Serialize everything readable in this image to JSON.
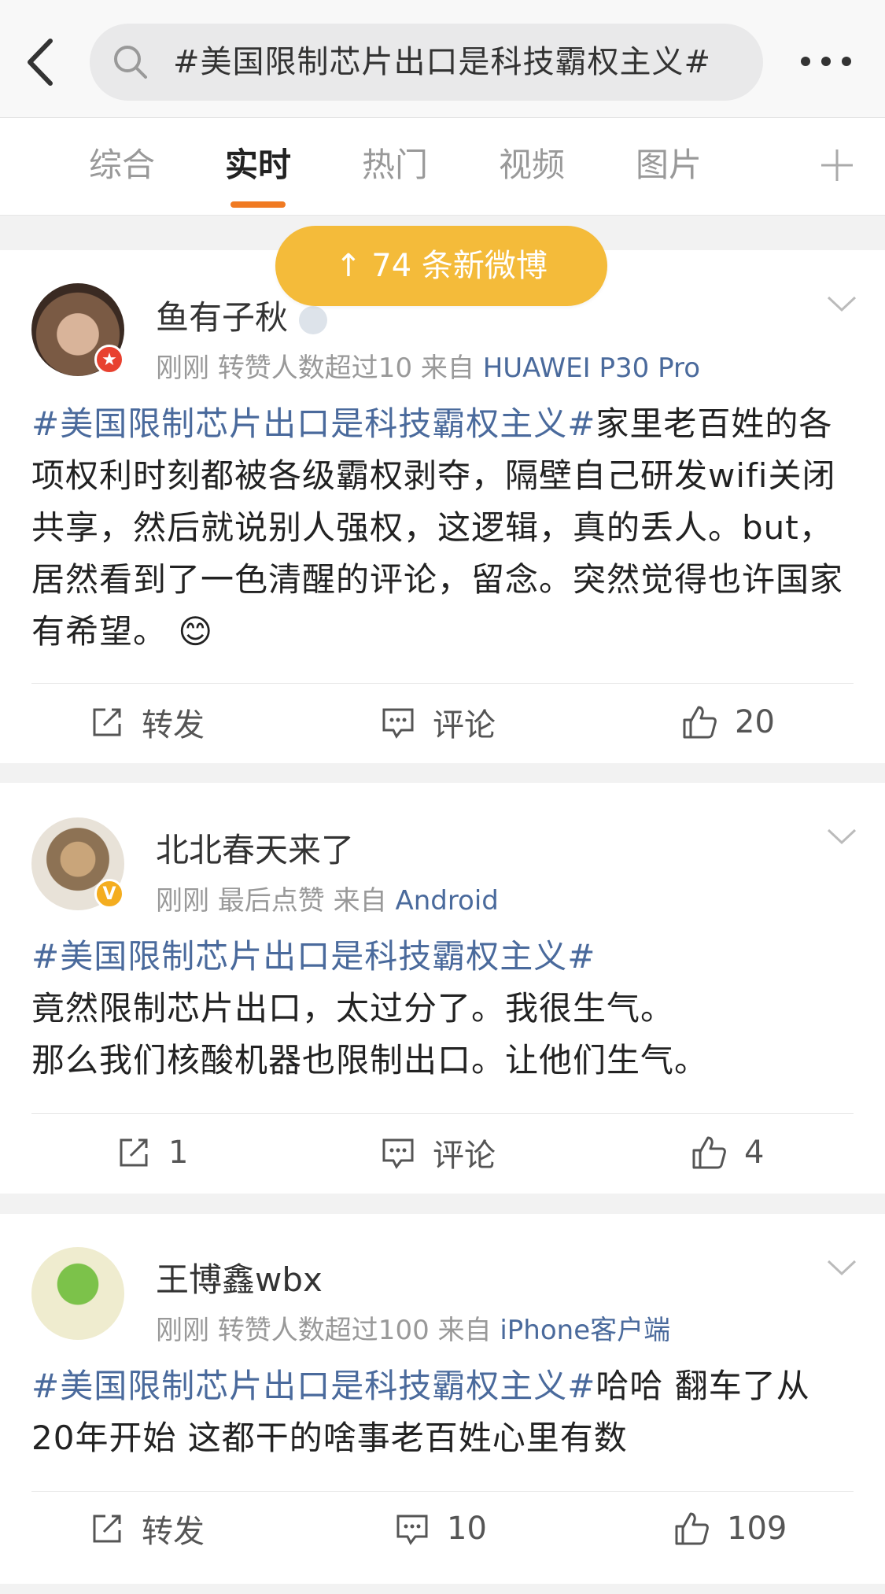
{
  "search": {
    "query": "#美国限制芯片出口是科技霸权主义#"
  },
  "tabs": [
    {
      "label": "综合"
    },
    {
      "label": "实时"
    },
    {
      "label": "热门"
    },
    {
      "label": "视频"
    },
    {
      "label": "图片"
    }
  ],
  "new_posts_pill": "↑ 74 条新微博",
  "colors": {
    "accent": "#f07a22",
    "pill": "#f4bb3a",
    "link": "#4a6a9c"
  },
  "posts": [
    {
      "username": "鱼有子秋",
      "time": "刚刚",
      "note": "转赞人数超过10",
      "from_label": "来自",
      "source": "HUAWEI P30 Pro",
      "topic": "#美国限制芯片出口是科技霸权主义#",
      "body": "家里老百姓的各项权利时刻都被各级霸权剥夺，隔壁自己研发wifi关闭共享，然后就说别人强权，这逻辑，真的丢人。but， 居然看到了一色清醒的评论，留念。突然觉得也许国家有希望。",
      "emoji": "😊",
      "repost": "转发",
      "comment": "评论",
      "like": "20"
    },
    {
      "username": "北北春天来了",
      "time": "刚刚",
      "note": "最后点赞",
      "from_label": "来自",
      "source": "Android",
      "topic": "#美国限制芯片出口是科技霸权主义#",
      "body_line1": "竟然限制芯片出口，太过分了。我很生气。",
      "body_line2": "那么我们核酸机器也限制出口。让他们生气。",
      "repost": "1",
      "comment": "评论",
      "like": "4"
    },
    {
      "username": "王博鑫wbx",
      "time": "刚刚",
      "note": "转赞人数超过100",
      "from_label": "来自",
      "source": "iPhone客户端",
      "topic": "#美国限制芯片出口是科技霸权主义#",
      "body": "哈哈 翻车了从20年开始 这都干的啥事老百姓心里有数",
      "repost": "转发",
      "comment": "10",
      "like": "109"
    }
  ]
}
